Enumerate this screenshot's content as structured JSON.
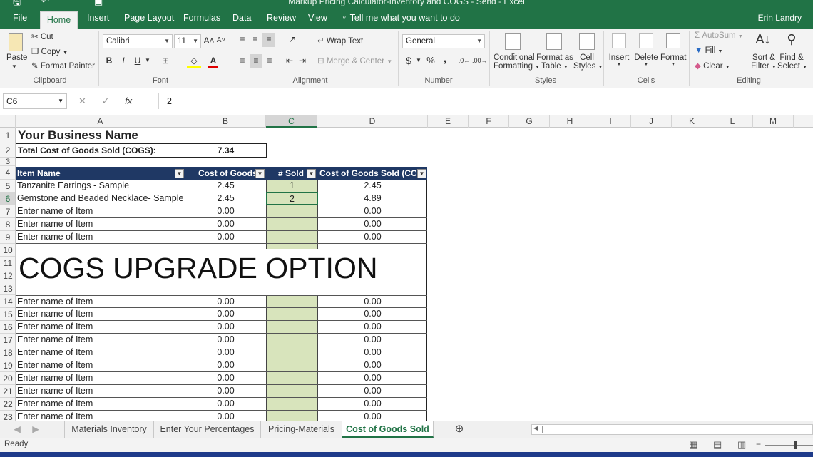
{
  "window": {
    "title": "Markup Pricing Calculator-Inventory and COGS - Send - Excel",
    "user": "Erin Landry"
  },
  "ribbon": {
    "tabs": [
      "File",
      "Home",
      "Insert",
      "Page Layout",
      "Formulas",
      "Data",
      "Review",
      "View"
    ],
    "active_tab": "Home",
    "tell_me": "Tell me what you want to do",
    "clipboard": {
      "paste": "Paste",
      "cut": "Cut",
      "copy": "Copy",
      "format_painter": "Format Painter",
      "label": "Clipboard"
    },
    "font": {
      "name": "Calibri",
      "size": "11",
      "bold": "B",
      "italic": "I",
      "underline": "U",
      "label": "Font"
    },
    "alignment": {
      "wrap_text": "Wrap Text",
      "merge_center": "Merge & Center",
      "label": "Alignment"
    },
    "number": {
      "format": "General",
      "currency": "$",
      "percent": "%",
      "comma": ",",
      "label": "Number"
    },
    "styles": {
      "conditional_1": "Conditional",
      "conditional_2": "Formatting",
      "format_as_1": "Format as",
      "format_as_2": "Table",
      "cell_styles_1": "Cell",
      "cell_styles_2": "Styles",
      "label": "Styles"
    },
    "cells": {
      "insert": "Insert",
      "delete": "Delete",
      "format": "Format",
      "label": "Cells"
    },
    "editing": {
      "autosum": "AutoSum",
      "fill": "Fill",
      "clear": "Clear",
      "sort_1": "Sort &",
      "sort_2": "Filter",
      "find_1": "Find &",
      "find_2": "Select",
      "label": "Editing"
    }
  },
  "formula_bar": {
    "name_box": "C6",
    "value": "2",
    "fx": "fx"
  },
  "columns": [
    "A",
    "B",
    "C",
    "D",
    "E",
    "F",
    "G",
    "H",
    "I",
    "J",
    "K",
    "L",
    "M"
  ],
  "selected_column": "C",
  "rows_visible": [
    "1",
    "2",
    "3",
    "4",
    "5",
    "6",
    "7",
    "8",
    "9",
    "10",
    "11",
    "12",
    "13",
    "14",
    "15",
    "16",
    "17",
    "18",
    "19",
    "20",
    "21",
    "22",
    "23"
  ],
  "selected_row": "6",
  "sheet": {
    "business_name": "Your Business Name",
    "cogs_total_label": "Total Cost of Goods Sold (COGS):",
    "cogs_total_value": "7.34",
    "headers": [
      "Item Name",
      "Cost of Goods",
      "# Sold",
      "Cost of Goods Sold (COG"
    ],
    "rows": [
      {
        "row": "5",
        "item": "Tanzanite Earrings - Sample",
        "cost": "2.45",
        "sold": "1",
        "cogs": "2.45"
      },
      {
        "row": "6",
        "item": "Gemstone and Beaded Necklace- Sample",
        "cost": "2.45",
        "sold": "2",
        "cogs": "4.89"
      },
      {
        "row": "7",
        "item": "Enter name of Item",
        "cost": "0.00",
        "sold": "",
        "cogs": "0.00"
      },
      {
        "row": "8",
        "item": "Enter name of Item",
        "cost": "0.00",
        "sold": "",
        "cogs": "0.00"
      },
      {
        "row": "9",
        "item": "Enter name of Item",
        "cost": "0.00",
        "sold": "",
        "cogs": "0.00"
      },
      {
        "row": "14",
        "item": "Enter name of Item",
        "cost": "0.00",
        "sold": "",
        "cogs": "0.00"
      },
      {
        "row": "15",
        "item": "Enter name of Item",
        "cost": "0.00",
        "sold": "",
        "cogs": "0.00"
      },
      {
        "row": "16",
        "item": "Enter name of Item",
        "cost": "0.00",
        "sold": "",
        "cogs": "0.00"
      },
      {
        "row": "17",
        "item": "Enter name of Item",
        "cost": "0.00",
        "sold": "",
        "cogs": "0.00"
      },
      {
        "row": "18",
        "item": "Enter name of Item",
        "cost": "0.00",
        "sold": "",
        "cogs": "0.00"
      },
      {
        "row": "19",
        "item": "Enter name of Item",
        "cost": "0.00",
        "sold": "",
        "cogs": "0.00"
      },
      {
        "row": "20",
        "item": "Enter name of Item",
        "cost": "0.00",
        "sold": "",
        "cogs": "0.00"
      },
      {
        "row": "21",
        "item": "Enter name of Item",
        "cost": "0.00",
        "sold": "",
        "cogs": "0.00"
      },
      {
        "row": "22",
        "item": "Enter name of Item",
        "cost": "0.00",
        "sold": "",
        "cogs": "0.00"
      },
      {
        "row": "23",
        "item": "Enter name of Item",
        "cost": "0.00",
        "sold": "",
        "cogs": "0.00"
      }
    ],
    "overlay_text": "COGS UPGRADE OPTION",
    "colors": {
      "header_bg": "#1f3864",
      "sold_col_bg": "#d8e4bc",
      "accent": "#217346"
    }
  },
  "sheet_tabs": [
    "Materials Inventory",
    "Enter Your Percentages",
    "Pricing-Materials",
    "Cost of Goods Sold"
  ],
  "active_sheet": "Cost of Goods Sold",
  "status": {
    "text": "Ready"
  }
}
